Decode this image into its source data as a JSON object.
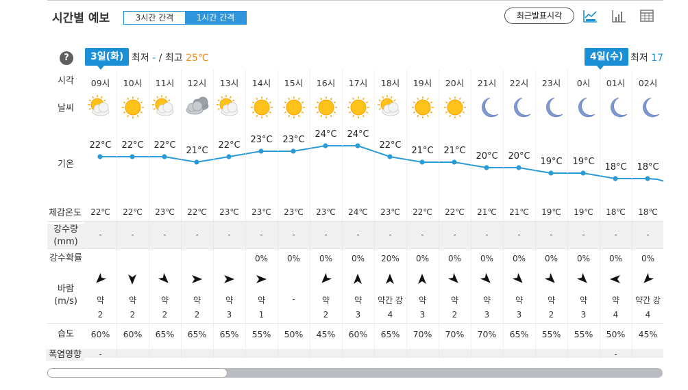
{
  "header": {
    "title": "시간별 예보",
    "tabs": [
      {
        "label": "3시간 간격",
        "active": false
      },
      {
        "label": "1시간 간격",
        "active": true
      }
    ],
    "recent_button": "최근발표시각",
    "view_icons": [
      "line-chart-icon",
      "bar-chart-icon",
      "table-icon"
    ]
  },
  "day1": {
    "date": "3일(화)",
    "min_label": "최저",
    "min_value": "-",
    "sep": "/",
    "max_label": "최고",
    "max_value": "25℃"
  },
  "day2": {
    "date": "4일(수)",
    "min_label": "최저",
    "min_value": "17"
  },
  "row_labels": {
    "time": "시각",
    "weather": "날씨",
    "temp": "기온",
    "feels": "체감온도",
    "rain_line1": "강수량",
    "rain_line2": "(mm)",
    "prob": "강수확률",
    "wind_line1": "바람",
    "wind_line2": "(m/s)",
    "humidity": "습도",
    "heat": "폭염영향"
  },
  "hours": [
    {
      "time": "09시",
      "icon": "partly-cloudy",
      "temp": "22°C",
      "feels": "22℃",
      "rain": "-",
      "prob": "",
      "wind_dir": "sw",
      "wind_str": "약",
      "wind_spd": "2",
      "humidity": "60%",
      "heat": "-"
    },
    {
      "time": "10시",
      "icon": "sunny",
      "temp": "22°C",
      "feels": "22℃",
      "rain": "-",
      "prob": "",
      "wind_dir": "s",
      "wind_str": "약",
      "wind_spd": "2",
      "humidity": "60%",
      "heat": ""
    },
    {
      "time": "11시",
      "icon": "partly-cloudy",
      "temp": "22°C",
      "feels": "23℃",
      "rain": "-",
      "prob": "",
      "wind_dir": "se",
      "wind_str": "약",
      "wind_spd": "2",
      "humidity": "65%",
      "heat": ""
    },
    {
      "time": "12시",
      "icon": "cloudy",
      "temp": "21°C",
      "feels": "22℃",
      "rain": "-",
      "prob": "",
      "wind_dir": "e",
      "wind_str": "약",
      "wind_spd": "2",
      "humidity": "65%",
      "heat": ""
    },
    {
      "time": "13시",
      "icon": "partly-cloudy",
      "temp": "22°C",
      "feels": "23℃",
      "rain": "-",
      "prob": "",
      "wind_dir": "e",
      "wind_str": "약",
      "wind_spd": "3",
      "humidity": "65%",
      "heat": ""
    },
    {
      "time": "14시",
      "icon": "sunny",
      "temp": "23°C",
      "feels": "23℃",
      "rain": "-",
      "prob": "0%",
      "wind_dir": "e",
      "wind_str": "약",
      "wind_spd": "1",
      "humidity": "55%",
      "heat": ""
    },
    {
      "time": "15시",
      "icon": "sunny",
      "temp": "23°C",
      "feels": "23℃",
      "rain": "-",
      "prob": "0%",
      "wind_dir": "none",
      "wind_str": "-",
      "wind_spd": "",
      "humidity": "50%",
      "heat": ""
    },
    {
      "time": "16시",
      "icon": "sunny",
      "temp": "24°C",
      "feels": "23℃",
      "rain": "-",
      "prob": "0%",
      "wind_dir": "sw",
      "wind_str": "약",
      "wind_spd": "2",
      "humidity": "45%",
      "heat": ""
    },
    {
      "time": "17시",
      "icon": "sunny",
      "temp": "24°C",
      "feels": "24℃",
      "rain": "-",
      "prob": "0%",
      "wind_dir": "n",
      "wind_str": "약",
      "wind_spd": "3",
      "humidity": "60%",
      "heat": ""
    },
    {
      "time": "18시",
      "icon": "partly-cloudy",
      "temp": "22°C",
      "feels": "23℃",
      "rain": "-",
      "prob": "20%",
      "wind_dir": "n",
      "wind_str": "약간 강",
      "wind_spd": "4",
      "humidity": "65%",
      "heat": ""
    },
    {
      "time": "19시",
      "icon": "sunny",
      "temp": "21°C",
      "feels": "22℃",
      "rain": "-",
      "prob": "0%",
      "wind_dir": "n",
      "wind_str": "약",
      "wind_spd": "3",
      "humidity": "70%",
      "heat": ""
    },
    {
      "time": "20시",
      "icon": "sunny",
      "temp": "21°C",
      "feels": "22℃",
      "rain": "-",
      "prob": "0%",
      "wind_dir": "se",
      "wind_str": "약",
      "wind_spd": "2",
      "humidity": "70%",
      "heat": ""
    },
    {
      "time": "21시",
      "icon": "moon",
      "temp": "20°C",
      "feels": "21℃",
      "rain": "-",
      "prob": "0%",
      "wind_dir": "se",
      "wind_str": "약",
      "wind_spd": "3",
      "humidity": "70%",
      "heat": ""
    },
    {
      "time": "22시",
      "icon": "moon",
      "temp": "20°C",
      "feels": "21℃",
      "rain": "-",
      "prob": "0%",
      "wind_dir": "se",
      "wind_str": "약",
      "wind_spd": "3",
      "humidity": "65%",
      "heat": ""
    },
    {
      "time": "23시",
      "icon": "moon",
      "temp": "19°C",
      "feels": "19℃",
      "rain": "-",
      "prob": "0%",
      "wind_dir": "se",
      "wind_str": "약",
      "wind_spd": "2",
      "humidity": "55%",
      "heat": ""
    },
    {
      "time": "0시",
      "icon": "moon",
      "temp": "19°C",
      "feels": "19℃",
      "rain": "-",
      "prob": "0%",
      "wind_dir": "se",
      "wind_str": "약",
      "wind_spd": "3",
      "humidity": "55%",
      "heat": ""
    },
    {
      "time": "01시",
      "icon": "moon",
      "temp": "18°C",
      "feels": "18℃",
      "rain": "-",
      "prob": "0%",
      "wind_dir": "w",
      "wind_str": "약",
      "wind_spd": "4",
      "humidity": "50%",
      "heat": "-"
    },
    {
      "time": "02시",
      "icon": "moon",
      "temp": "18°C",
      "feels": "18℃",
      "rain": "-",
      "prob": "0%",
      "wind_dir": "sw",
      "wind_str": "약간 강",
      "wind_spd": "4",
      "humidity": "45%",
      "heat": ""
    }
  ],
  "colors": {
    "accent": "#1a8fd6",
    "max_temp": "#f08c1c",
    "line": "#2a9bd8",
    "sun": "#f5a300",
    "moon": "#7f99cf"
  }
}
